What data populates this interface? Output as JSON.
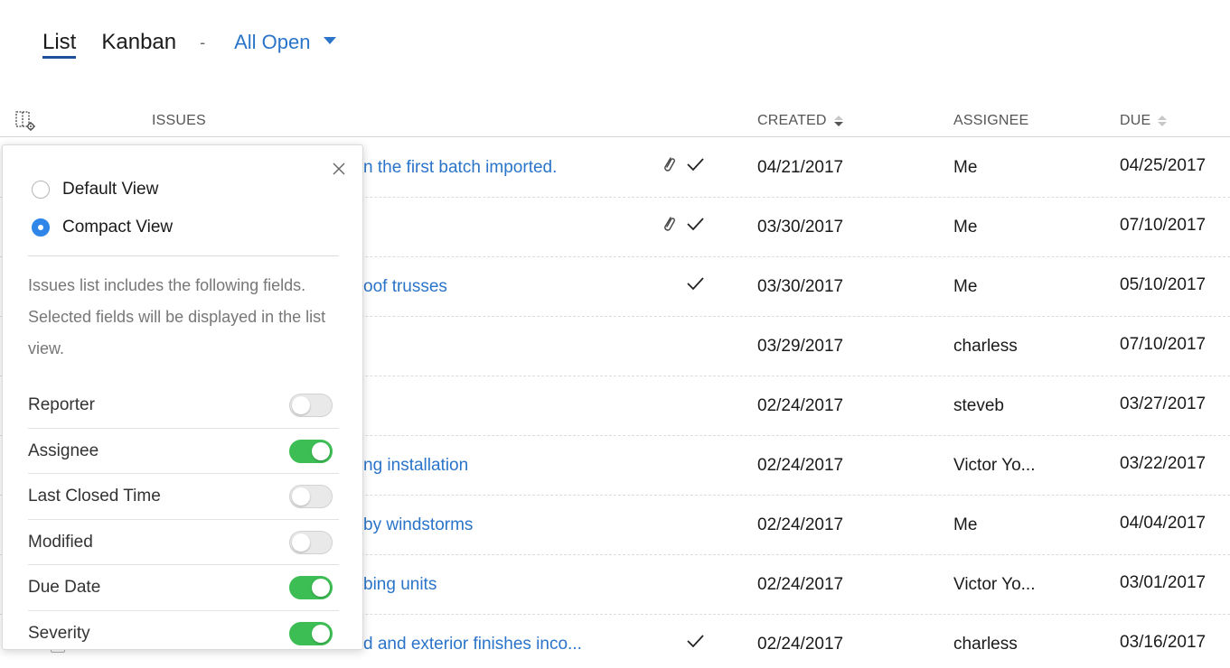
{
  "view_tabs": {
    "list": "List",
    "kanban": "Kanban",
    "separator": "-",
    "filter": "All Open"
  },
  "columns": {
    "issues": "ISSUES",
    "created": "CREATED",
    "assignee": "ASSIGNEE",
    "due": "DUE"
  },
  "rows": [
    {
      "title": "n the first batch imported.",
      "id": "",
      "attachment": true,
      "done": true,
      "created": "04/21/2017",
      "assignee": "Me",
      "due": "04/25/2017"
    },
    {
      "title": "",
      "id": "",
      "attachment": true,
      "done": true,
      "created": "03/30/2017",
      "assignee": "Me",
      "due": "07/10/2017"
    },
    {
      "title": "oof trusses",
      "id": "",
      "attachment": false,
      "done": true,
      "created": "03/30/2017",
      "assignee": "Me",
      "due": "05/10/2017"
    },
    {
      "title": "",
      "id": "",
      "attachment": false,
      "done": false,
      "created": "03/29/2017",
      "assignee": "charless",
      "due": "07/10/2017"
    },
    {
      "title": "",
      "id": "",
      "attachment": false,
      "done": false,
      "created": "02/24/2017",
      "assignee": "steveb",
      "due": "03/27/2017"
    },
    {
      "title": "ng installation",
      "id": "",
      "attachment": false,
      "done": false,
      "created": "02/24/2017",
      "assignee": "Victor Yo...",
      "due": "03/22/2017"
    },
    {
      "title": "by windstorms",
      "id": "",
      "attachment": false,
      "done": false,
      "created": "02/24/2017",
      "assignee": "Me",
      "due": "04/04/2017"
    },
    {
      "title": "bing units",
      "id": "",
      "attachment": false,
      "done": false,
      "created": "02/24/2017",
      "assignee": "Victor Yo...",
      "due": "03/01/2017"
    },
    {
      "title": "d and exterior finishes inco...",
      "id": "",
      "attachment": false,
      "done": true,
      "created": "02/24/2017",
      "assignee": "charless",
      "due": "03/16/2017"
    }
  ],
  "popover": {
    "view_options": [
      {
        "label": "Default View",
        "selected": false
      },
      {
        "label": "Compact View",
        "selected": true
      }
    ],
    "description": "Issues list includes the following fields. Selected fields will be displayed in the list view.",
    "fields": [
      {
        "label": "Reporter",
        "enabled": false
      },
      {
        "label": "Assignee",
        "enabled": true
      },
      {
        "label": "Last Closed Time",
        "enabled": false
      },
      {
        "label": "Modified",
        "enabled": false
      },
      {
        "label": "Due Date",
        "enabled": true
      },
      {
        "label": "Severity",
        "enabled": true
      }
    ]
  },
  "colors": {
    "accent_blue": "#2a74c9",
    "radio_blue": "#2f86e8",
    "toggle_green": "#3dbe55",
    "tab_underline": "#1f4e9b"
  },
  "icons": {
    "settings": "column-settings-icon",
    "close": "close-icon",
    "attachment": "attachment-icon",
    "done": "checkmark-icon",
    "filter_caret": "caret-down-icon"
  }
}
